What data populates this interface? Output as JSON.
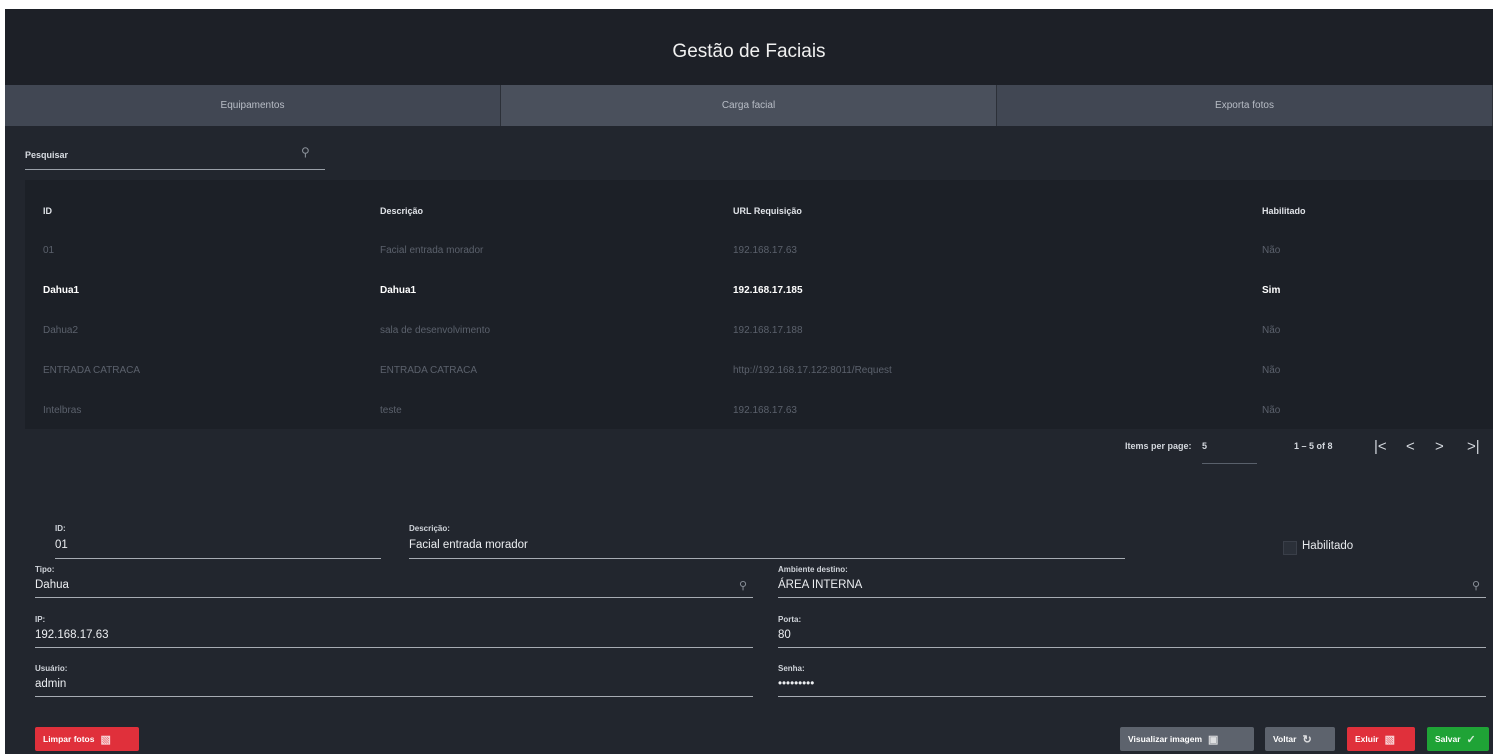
{
  "header": {
    "title": "Gestão de Faciais"
  },
  "tabs": [
    {
      "label": "Equipamentos"
    },
    {
      "label": "Carga facial"
    },
    {
      "label": "Exporta fotos"
    }
  ],
  "search": {
    "label": "Pesquisar",
    "icon": "search-icon"
  },
  "table": {
    "columns": [
      "ID",
      "Descrição",
      "URL Requisição",
      "Habilitado"
    ],
    "rows": [
      [
        "01",
        "Facial entrada morador",
        "192.168.17.63",
        "Não"
      ],
      [
        "Dahua1",
        "Dahua1",
        "192.168.17.185",
        "Sim"
      ],
      [
        "Dahua2",
        "sala de desenvolvimento",
        "192.168.17.188",
        "Não"
      ],
      [
        "ENTRADA CATRACA",
        "ENTRADA CATRACA",
        "http://192.168.17.122:8011/Request",
        "Não"
      ],
      [
        "Intelbras",
        "teste",
        "192.168.17.63",
        "Não"
      ]
    ]
  },
  "paginator": {
    "items_per_page_label": "Items per page:",
    "items_per_page_value": "5",
    "range": "1 – 5 of 8",
    "first": "|<",
    "prev": "<",
    "next": ">",
    "last": ">|"
  },
  "form": {
    "id": {
      "label": "ID:",
      "value": "01"
    },
    "descricao": {
      "label": "Descrição:",
      "value": "Facial entrada morador"
    },
    "habilitado": {
      "label": "Habilitado",
      "checked": false
    },
    "tipo": {
      "label": "Tipo:",
      "value": "Dahua"
    },
    "ambiente": {
      "label": "Ambiente destino:",
      "value": "ÁREA INTERNA"
    },
    "ip": {
      "label": "IP:",
      "value": "192.168.17.63"
    },
    "porta": {
      "label": "Porta:",
      "value": "80"
    },
    "usuario": {
      "label": "Usuário:",
      "value": "admin"
    },
    "senha": {
      "label": "Senha:",
      "value": "•••••••••"
    }
  },
  "buttons": {
    "limpar": "Limpar fotos",
    "visualizar": "Visualizar imagem",
    "voltar": "Voltar",
    "excluir": "Exluir",
    "salvar": "Salvar"
  },
  "colors": {
    "background": "#22262e",
    "table_background": "#1c2027",
    "tab_background": "#414753",
    "danger": "#e0303b",
    "success": "#1fa336",
    "neutral_button": "#5d636d"
  }
}
